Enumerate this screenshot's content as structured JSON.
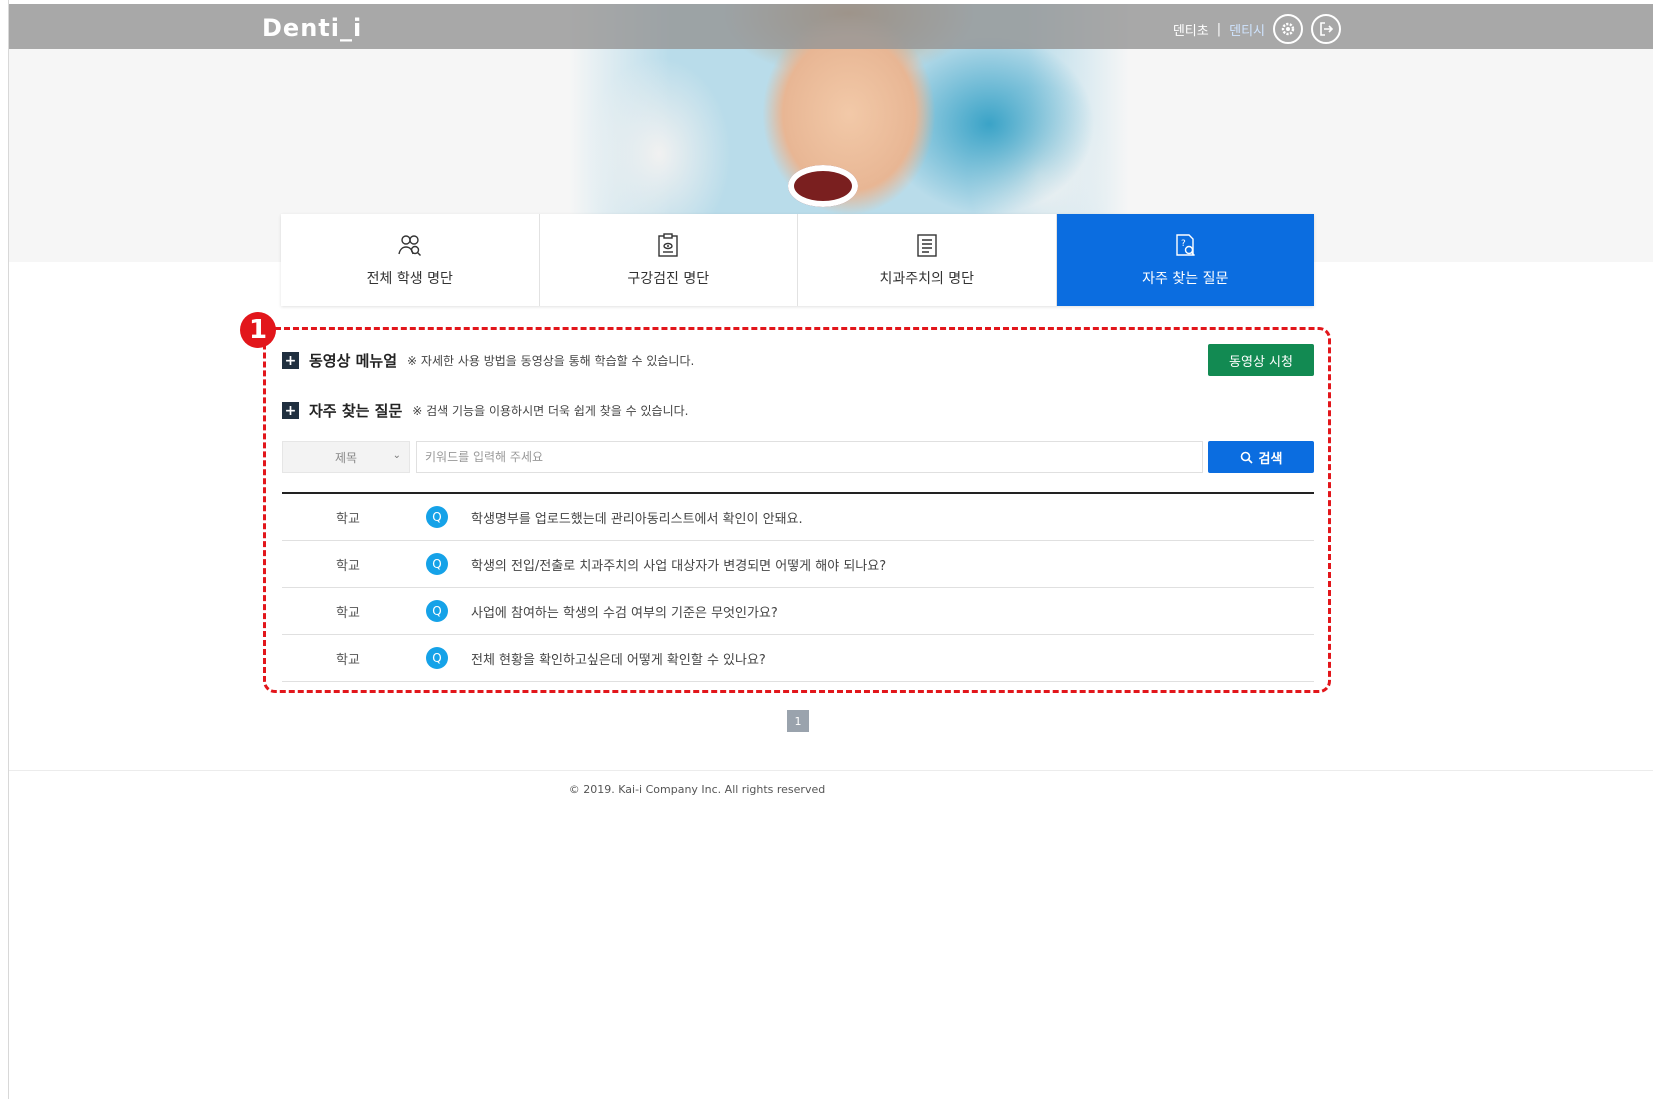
{
  "header": {
    "logo": "Denti_i",
    "links": [
      "덴티초",
      "덴티시"
    ],
    "separator": "|",
    "settings_icon": "gear-icon",
    "logout_icon": "logout-icon"
  },
  "tabs": [
    {
      "label": "전체 학생 명단",
      "icon": "students-icon"
    },
    {
      "label": "구강검진 명단",
      "icon": "clipboard-icon"
    },
    {
      "label": "치과주치의 명단",
      "icon": "document-list-icon"
    },
    {
      "label": "자주 찾는 질문",
      "icon": "faq-search-icon",
      "active": true
    }
  ],
  "annotation_badge": "1",
  "video_section": {
    "title": "동영상 메뉴얼",
    "note": "※ 자세한 사용 방법을 동영상을 통해 학습할 수 있습니다.",
    "button": "동영상 시청"
  },
  "faq_section": {
    "title": "자주 찾는 질문",
    "note": "※ 검색 기능을 이용하시면 더욱 쉽게 찾을 수 있습니다."
  },
  "search": {
    "select_value": "제목",
    "placeholder": "키워드를 입력해 주세요",
    "button": "검색"
  },
  "faq_items": [
    {
      "category": "학교",
      "q": "Q",
      "text": "학생명부를 업로드했는데 관리아동리스트에서 확인이 안돼요."
    },
    {
      "category": "학교",
      "q": "Q",
      "text": "학생의 전입/전출로 치과주치의 사업 대상자가 변경되면 어떻게 해야 되나요?"
    },
    {
      "category": "학교",
      "q": "Q",
      "text": "사업에 참여하는 학생의 수검 여부의 기준은 무엇인가요?"
    },
    {
      "category": "학교",
      "q": "Q",
      "text": "전체 현황을 확인하고싶은데 어떻게 확인할 수 있나요?"
    }
  ],
  "pagination": {
    "current": "1"
  },
  "footer": {
    "copyright": "© 2019. Kai-i Company Inc. All rights reserved"
  }
}
